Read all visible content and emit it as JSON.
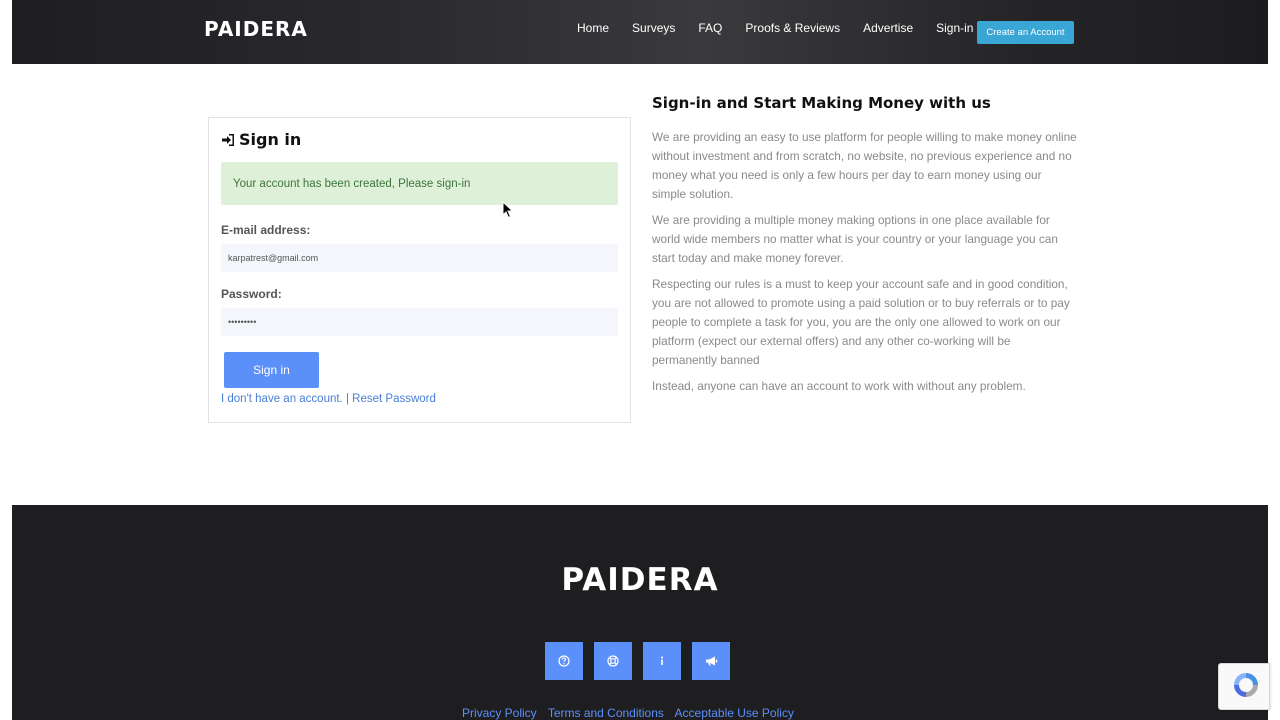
{
  "header": {
    "logo": "PAIDERA",
    "nav": [
      "Home",
      "Surveys",
      "FAQ",
      "Proofs & Reviews",
      "Advertise",
      "Sign-in"
    ],
    "create_account": "Create an Account"
  },
  "signin": {
    "title": "Sign in",
    "alert": "Your account has been created, Please sign-in",
    "email_label": "E-mail address:",
    "email_value": "karpatrest@gmail.com",
    "password_label": "Password:",
    "password_value": "•••••••••",
    "button": "Sign in",
    "no_account_link": "I don't have an account.",
    "separator": " | ",
    "reset_link": "Reset Password"
  },
  "info": {
    "heading": "Sign-in and Start Making Money with us",
    "paragraphs": [
      "We are providing an easy to use platform for people willing to make money online without investment and from scratch, no website, no previous experience and no money what you need is only a few hours per day to earn money using our simple solution.",
      "We are providing a multiple money making options in one place available for world wide members no matter what is your country or your language you can start today and make money forever.",
      "Respecting our rules is a must to keep your account safe and in good condition, you are not allowed to promote using a paid solution or to buy referrals or to pay people to complete a task for you, you are the only one allowed to work on our platform (expect our external offers) and any other co-working will be permanently banned",
      "Instead, anyone can have an account to work with without any problem."
    ]
  },
  "footer": {
    "logo": "PAIDERA",
    "social_icons": [
      "question-icon",
      "lifebuoy-icon",
      "info-icon",
      "megaphone-icon"
    ],
    "links": [
      "Privacy Policy",
      "Terms and Conditions",
      "Acceptable Use Policy"
    ]
  },
  "colors": {
    "accent": "#5b8ff9",
    "header_button": "#3aa6d6",
    "alert_bg": "#dff0d8",
    "footer_bg": "#1e1e20"
  }
}
